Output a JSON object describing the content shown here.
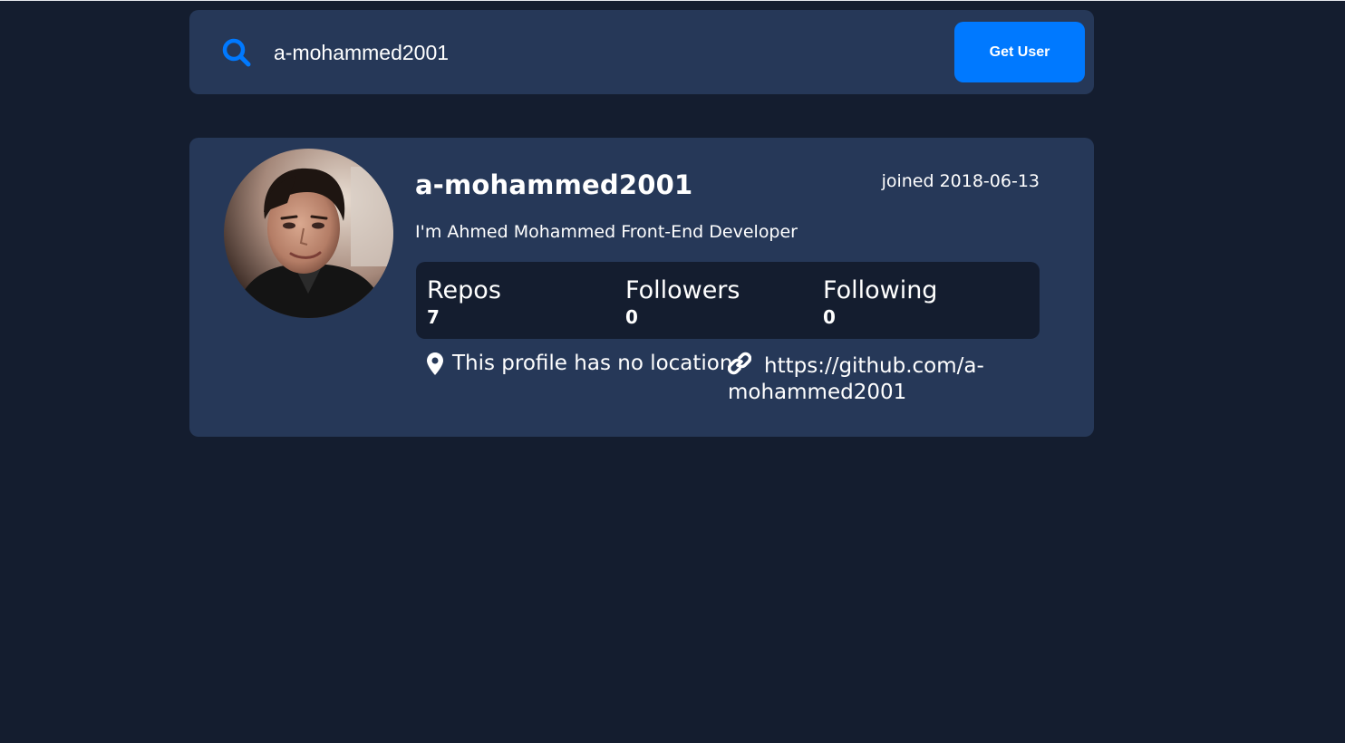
{
  "search": {
    "value": "a-mohammed2001",
    "button_label": "Get User"
  },
  "profile": {
    "username": "a-mohammed2001",
    "joined": "joined 2018-06-13",
    "bio": "I'm Ahmed Mohammed Front-End Developer",
    "stats": [
      {
        "label": "Repos",
        "value": "7"
      },
      {
        "label": "Followers",
        "value": "0"
      },
      {
        "label": "Following",
        "value": "0"
      }
    ],
    "location": "This profile has no location",
    "blog": "https://github.com/a-mohammed2001"
  },
  "colors": {
    "background": "#141d2f",
    "card": "#263858",
    "accent": "#0079ff",
    "text": "#ffffff"
  },
  "icons": {
    "search": "search-icon",
    "location": "map-pin-icon",
    "link": "link-icon"
  }
}
